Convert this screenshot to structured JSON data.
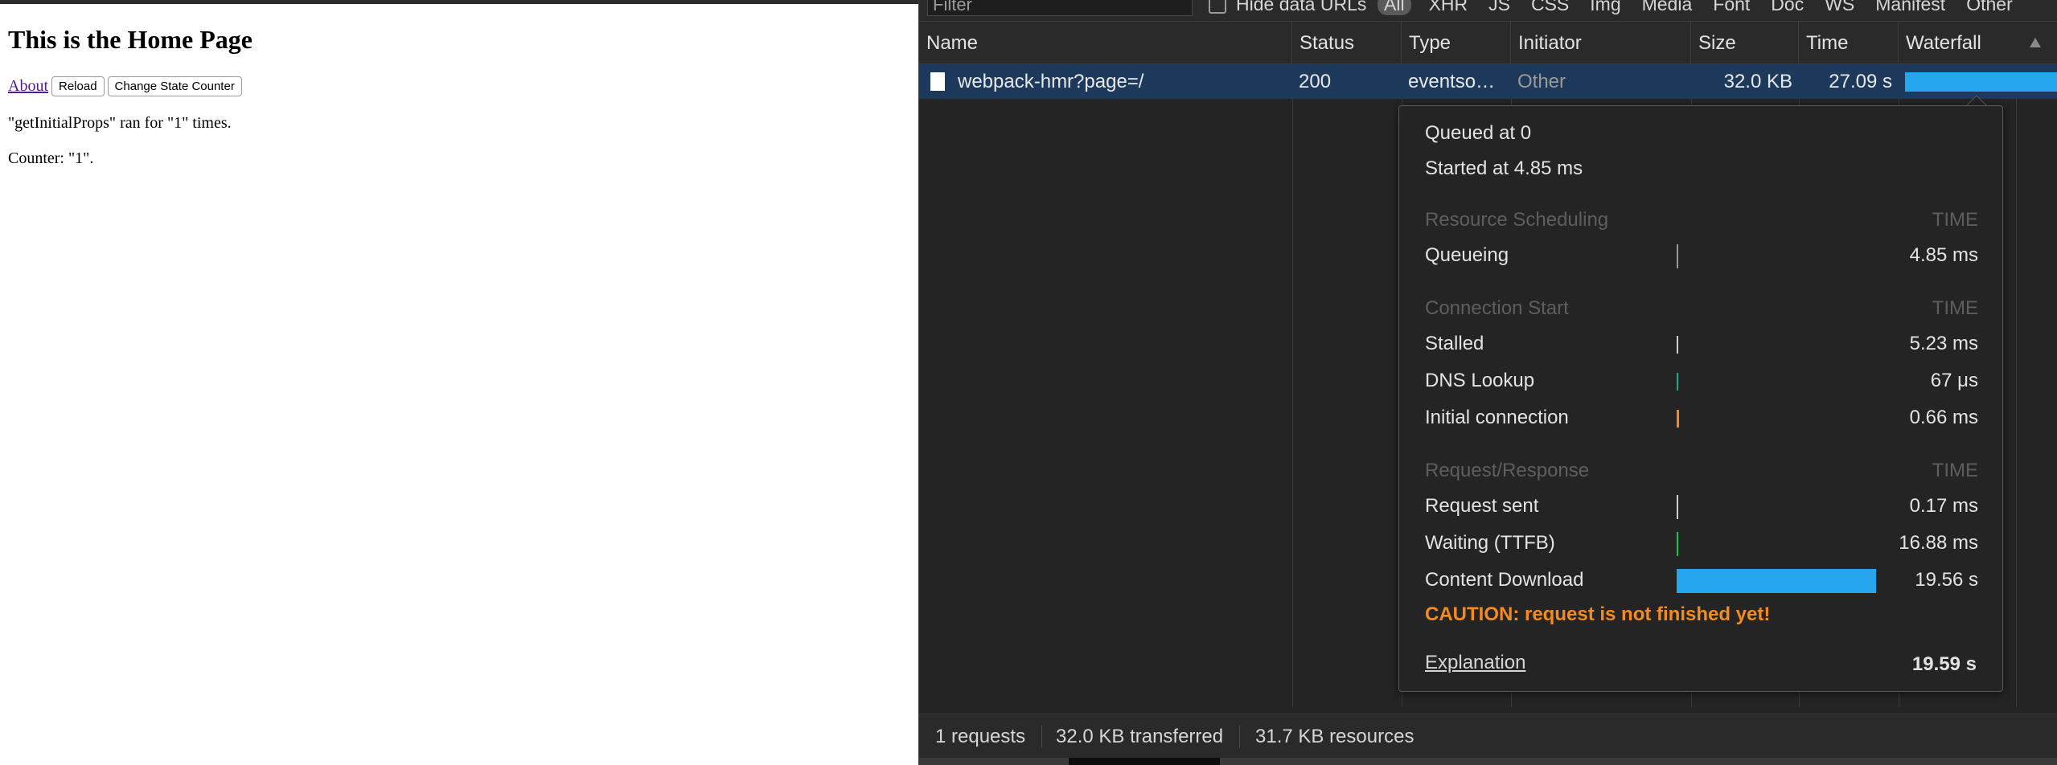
{
  "page": {
    "title": "This is the Home Page",
    "about_link": "About",
    "reload_button": "Reload",
    "change_state_button": "Change State Counter",
    "props_text": "\"getInitialProps\" ran for \"1\" times.",
    "counter_text": "Counter: \"1\"."
  },
  "devtools": {
    "filter_placeholder": "Filter",
    "hide_data_urls": "Hide data URLs",
    "type_filters": [
      "All",
      "XHR",
      "JS",
      "CSS",
      "Img",
      "Media",
      "Font",
      "Doc",
      "WS",
      "Manifest",
      "Other"
    ],
    "columns": {
      "name": "Name",
      "status": "Status",
      "type": "Type",
      "initiator": "Initiator",
      "size": "Size",
      "time": "Time",
      "waterfall": "Waterfall",
      "sort_icon": "triangle-up-icon"
    },
    "request": {
      "name": "webpack-hmr?page=/",
      "status": "200",
      "type": "eventso…",
      "initiator": "Other",
      "size": "32.0 KB",
      "time": "27.09 s"
    },
    "timing": {
      "queued_at": "Queued at 0",
      "started_at": "Started at 4.85 ms",
      "resource_scheduling": "Resource Scheduling",
      "connection_start": "Connection Start",
      "request_response": "Request/Response",
      "time_label": "TIME",
      "queueing": {
        "label": "Queueing",
        "value": "4.85 ms"
      },
      "stalled": {
        "label": "Stalled",
        "value": "5.23 ms"
      },
      "dns_lookup": {
        "label": "DNS Lookup",
        "value": "67 μs"
      },
      "initial_connection": {
        "label": "Initial connection",
        "value": "0.66 ms"
      },
      "request_sent": {
        "label": "Request sent",
        "value": "0.17 ms"
      },
      "waiting": {
        "label": "Waiting (TTFB)",
        "value": "16.88 ms"
      },
      "content_download": {
        "label": "Content Download",
        "value": "19.56 s"
      },
      "caution": "CAUTION: request is not finished yet!",
      "explanation": "Explanation",
      "total": "19.59 s",
      "colors": {
        "queueing": "#9a9a9a",
        "stalled": "#cfcfcf",
        "dns": "#1fa588",
        "initial": "#f58b1f",
        "request_sent": "#cfcfcf",
        "waiting": "#1fbf4a",
        "download": "#26a6ef"
      }
    },
    "status_bar": {
      "requests": "1 requests",
      "transferred": "32.0 KB transferred",
      "resources": "31.7 KB resources"
    }
  }
}
